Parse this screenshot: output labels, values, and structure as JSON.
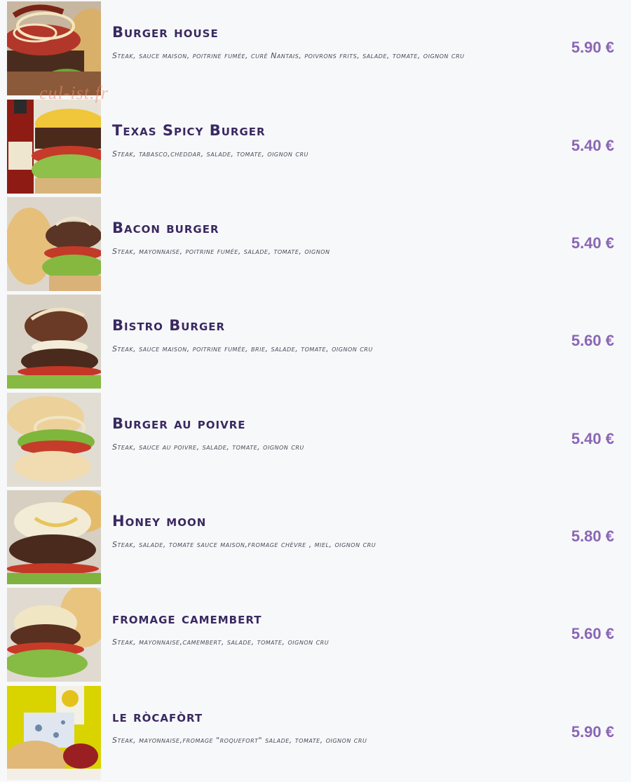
{
  "watermark": "cul-ist.fr",
  "colors": {
    "name": "#3a2960",
    "price": "#8a66b4",
    "description": "#4a4a5a",
    "background": "#f7f8fa"
  },
  "items": [
    {
      "name": "Burger house",
      "description": "Steak, sauce maison, poitrine fumée, curé Nantais, poivrons frits, salade, tomate, oignon cru",
      "price": "5.90 €",
      "photo": "burger-house-photo"
    },
    {
      "name": "Texas Spicy Burger",
      "description": "Steak, tabasco,cheddar, salade, tomate, oignon cru",
      "price": "5.40 €",
      "photo": "texas-spicy-burger-photo"
    },
    {
      "name": "Bacon burger",
      "description": "Steak, mayonnaise, poitrine fumée, salade, tomate, oignon",
      "price": "5.40 €",
      "photo": "bacon-burger-photo"
    },
    {
      "name": "Bistro Burger",
      "description": "Steak, sauce maison, poitrine fumée, brie, salade, tomate, oignon cru",
      "price": "5.60 €",
      "photo": "bistro-burger-photo"
    },
    {
      "name": "Burger au poivre",
      "description": "Steak, sauce au poivre, salade, tomate, oignon cru",
      "price": "5.40 €",
      "photo": "burger-au-poivre-photo"
    },
    {
      "name": "Honey moon",
      "description": "Steak, salade, tomate sauce maison,fromage chèvre , miel, oignon cru",
      "price": "5.80 €",
      "photo": "honey-moon-photo"
    },
    {
      "name": "fromage camembert",
      "description": "Steak, mayonnaise,camembert, salade, tomate, oignon cru",
      "price": "5.60 €",
      "photo": "fromage-camembert-photo"
    },
    {
      "name": "le ròcafòrt",
      "description": "Steak, mayonnaise,fromage \"roquefort\" salade, tomate, oignon cru",
      "price": "5.90 €",
      "photo": "le-rocafort-photo"
    }
  ]
}
